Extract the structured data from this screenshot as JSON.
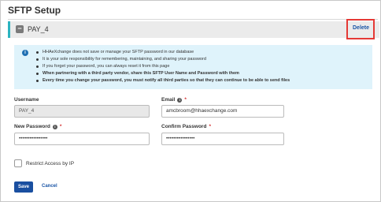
{
  "page": {
    "title": "SFTP Setup"
  },
  "section": {
    "collapse_symbol": "−",
    "name": "PAY_4",
    "delete_label": "Delete",
    "accent_color": "#2bb3c0"
  },
  "info": {
    "icon": "i",
    "lines": [
      "HHAeXchange does not save or manage your SFTP password in our database",
      "It is your sole responsibility for remembering, maintaining, and sharing your password",
      "If you forget your password, you can always reset it from this page",
      "When partnering with a third party vendor, share this SFTP User Name and Password with them",
      "Every time you change your password, you must notify all third parties so that they can continue to be able to send files"
    ]
  },
  "form": {
    "username": {
      "label": "Username",
      "value": "PAY_4"
    },
    "email": {
      "label": "Email",
      "required_mark": "*",
      "value": "amcbroom@hhaexchange.com"
    },
    "new_password": {
      "label": "New Password",
      "required_mark": "*",
      "value": "••••••••••••••••"
    },
    "confirm_password": {
      "label": "Confirm Password",
      "required_mark": "*",
      "value": "••••••••••••••••"
    },
    "restrict_ip": {
      "label": "Restrict Access by IP",
      "checked": false
    }
  },
  "actions": {
    "save_label": "Save",
    "cancel_label": "Cancel"
  }
}
